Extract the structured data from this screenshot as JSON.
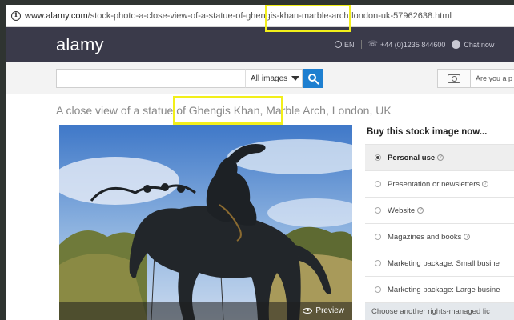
{
  "browser": {
    "url_domain": "www.alamy.com",
    "url_path": "/stock-photo-a-close-view-of-a-statue-of-ghengis-khan-marble-arch-london-uk-57962638.html"
  },
  "header": {
    "logo": "alamy",
    "language": "EN",
    "phone": "+44 (0)1235 844600",
    "chat_label": "Chat now"
  },
  "search": {
    "value": "",
    "filter_label": "All images",
    "prompt_text": "Are you a p"
  },
  "page": {
    "title": "A close view of a statue of Ghengis Khan, Marble Arch, London, UK"
  },
  "photo": {
    "preview_label": "Preview"
  },
  "buy": {
    "title": "Buy this stock image now...",
    "options": [
      {
        "label": "Personal use",
        "selected": true
      },
      {
        "label": "Presentation or newsletters",
        "selected": false
      },
      {
        "label": "Website",
        "selected": false
      },
      {
        "label": "Magazines and books",
        "selected": false
      },
      {
        "label": "Marketing package: Small busine",
        "selected": false
      },
      {
        "label": "Marketing package: Large busine",
        "selected": false
      }
    ],
    "choose_other": "Choose another rights-managed lic"
  },
  "colors": {
    "highlight": "#f2ef1a",
    "header_bg": "#3a3a4a",
    "search_button": "#1e7fd0"
  }
}
